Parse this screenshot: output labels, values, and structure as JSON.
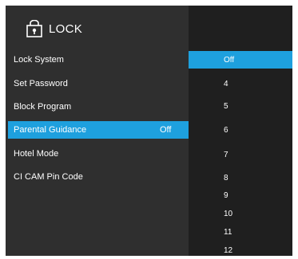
{
  "menu": {
    "title": "LOCK",
    "icon": "lock-icon",
    "accent_color": "#1ea0de",
    "items": [
      {
        "label": "Lock System",
        "value": ""
      },
      {
        "label": "Set Password",
        "value": ""
      },
      {
        "label": "Block Program",
        "value": ""
      },
      {
        "label": "Parental Guidance",
        "value": "Off"
      },
      {
        "label": "Hotel Mode",
        "value": ""
      },
      {
        "label": "CI CAM Pin Code",
        "value": ""
      }
    ],
    "selected_item": "Parental Guidance"
  },
  "options": {
    "items": [
      "Off",
      "4",
      "5",
      "6",
      "7",
      "8",
      "9",
      "10",
      "11",
      "12"
    ],
    "selected": "Off"
  }
}
